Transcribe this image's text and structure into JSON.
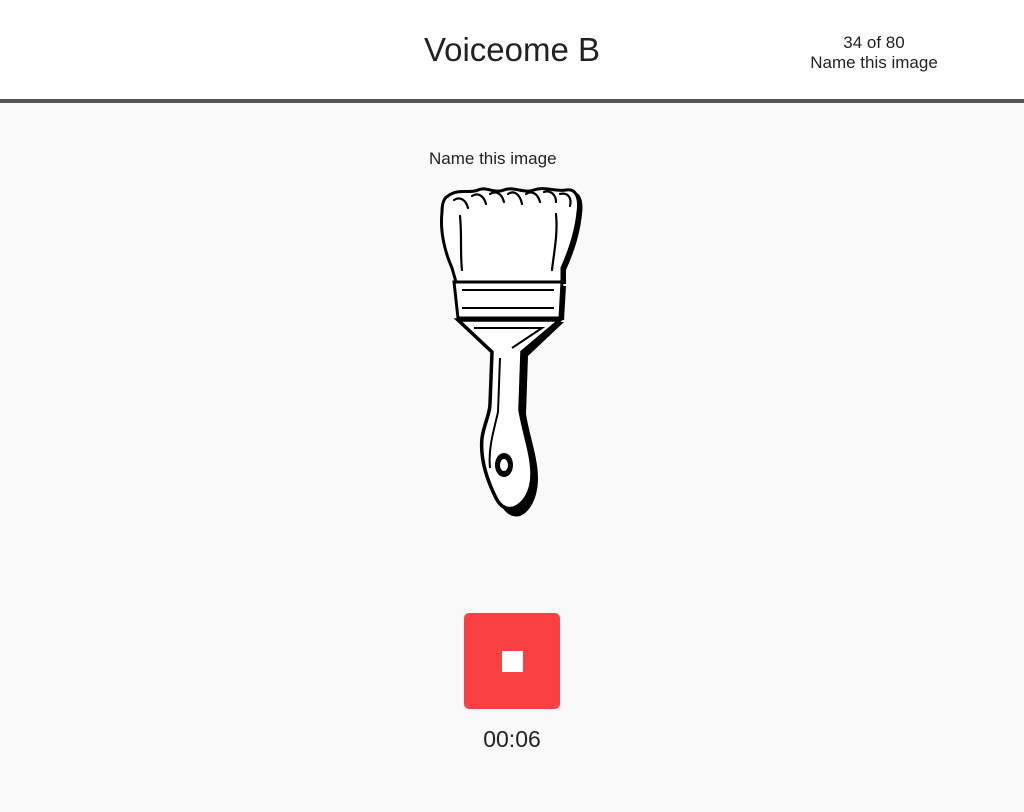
{
  "header": {
    "title": "Voiceome B",
    "progress_count": "34 of 80",
    "task_name": "Name this image"
  },
  "task": {
    "prompt": "Name this image",
    "stimulus_icon": "paintbrush-icon"
  },
  "recorder": {
    "button_icon": "stop-icon",
    "button_color": "#f94144",
    "elapsed": "00:06"
  },
  "colors": {
    "header_bg": "#ffffff",
    "header_border": "#555555",
    "page_bg": "#f9f9f9",
    "text": "#222222"
  }
}
